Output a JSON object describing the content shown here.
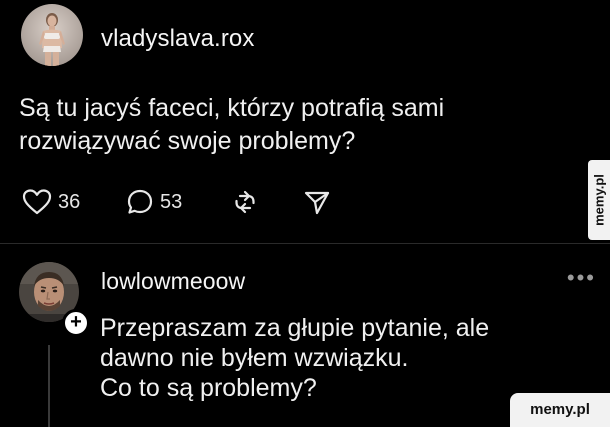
{
  "post": {
    "username": "vladyslava.rox",
    "text": "Są tu jacyś faceci, którzy potrafią sami rozwiązywać swoje problemy?",
    "likes": "36",
    "replies": "53"
  },
  "reply": {
    "username": "lowlowmeoow",
    "lines": [
      "Przepraszam za głupie pytanie, ale",
      "dawno nie byłem wzwiązku.",
      "Co to są problemy?"
    ],
    "follow_symbol": "+",
    "more_symbol": "•••"
  },
  "watermarks": {
    "side": "memy.pl",
    "bottom": "memy.pl"
  },
  "icons": {
    "like": "heart-icon",
    "reply": "comment-bubble-icon",
    "repost": "repost-icon",
    "share": "send-icon"
  }
}
